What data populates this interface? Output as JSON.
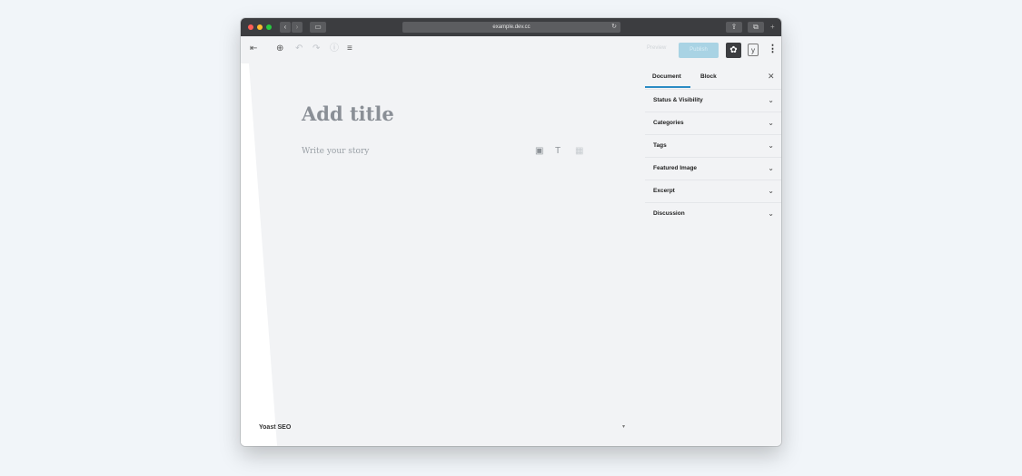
{
  "browser": {
    "url": "example.dev.cc"
  },
  "toolbar": {
    "preview_label": "Preview",
    "publish_label": "Publish"
  },
  "editor": {
    "title_placeholder": "Add title",
    "body_placeholder": "Write your story"
  },
  "sidebar": {
    "tabs": [
      {
        "label": "Document"
      },
      {
        "label": "Block"
      }
    ],
    "panels": [
      {
        "label": "Status & Visibility"
      },
      {
        "label": "Categories"
      },
      {
        "label": "Tags"
      },
      {
        "label": "Featured Image"
      },
      {
        "label": "Excerpt"
      },
      {
        "label": "Discussion"
      }
    ]
  },
  "footer": {
    "yoast_label": "Yoast SEO"
  },
  "colors": {
    "accent": "#2b8cc4",
    "publish_disabled": "#a9d3e4",
    "chrome": "#3c3d40"
  }
}
